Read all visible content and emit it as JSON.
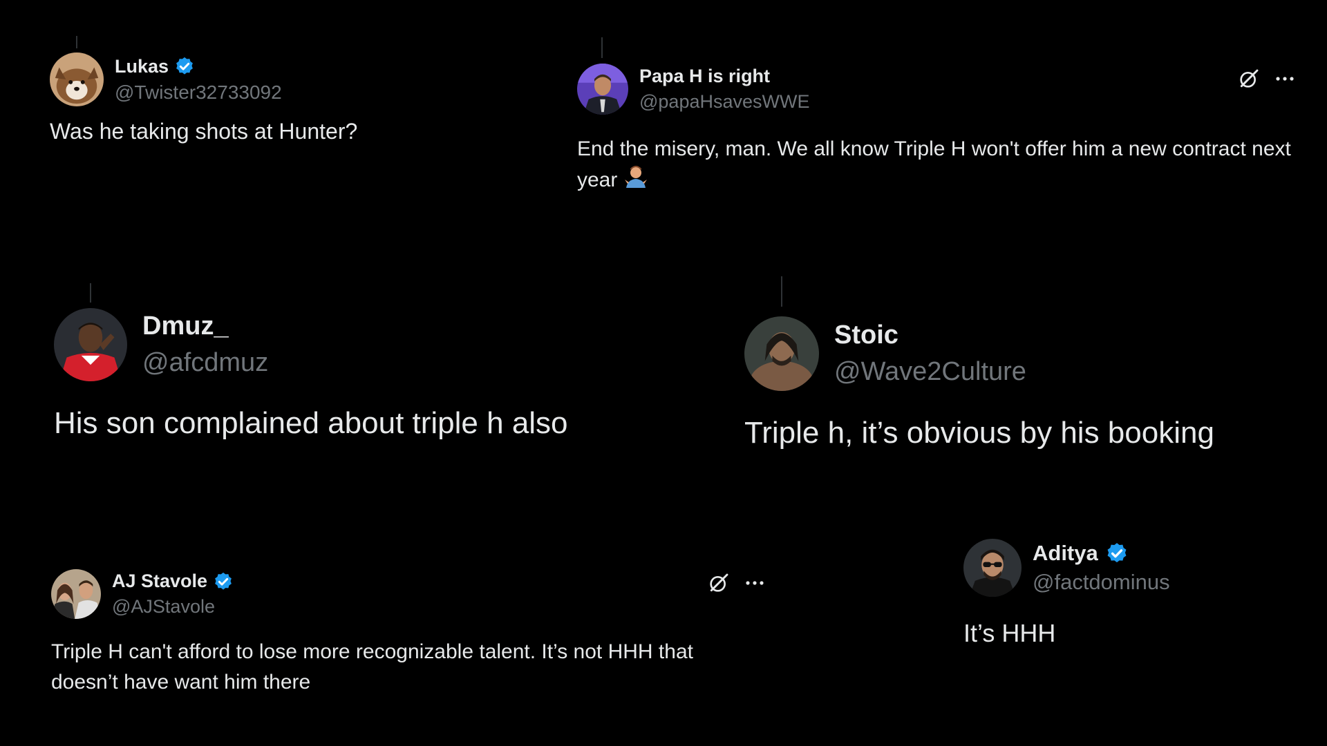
{
  "colors": {
    "background": "#000000",
    "text": "#e7e9ea",
    "handle": "#71767b",
    "verified": "#1d9bf0"
  },
  "tweets": [
    {
      "name": "Lukas",
      "handle": "@Twister32733092",
      "verified": true,
      "avatar_icon": "dog-avatar",
      "text": "Was he taking shots at Hunter?"
    },
    {
      "name": "Papa H is right",
      "handle": "@papaHsavesWWE",
      "verified": false,
      "avatar_icon": "man-in-suit-avatar",
      "text": "End the misery, man. We all know Triple H won't offer him a new contract next year",
      "emoji_icon": "person-shrugging-emoji",
      "action_icons": [
        "grok-icon",
        "more-icon"
      ]
    },
    {
      "name": "Dmuz_",
      "handle": "@afcdmuz",
      "verified": false,
      "avatar_icon": "footballer-avatar",
      "text": "His son complained about triple h also"
    },
    {
      "name": "Stoic",
      "handle": "@Wave2Culture",
      "verified": false,
      "avatar_icon": "wrestler-avatar",
      "text": "Triple h, it’s obvious by his booking"
    },
    {
      "name": "AJ Stavole",
      "handle": "@AJStavole",
      "verified": true,
      "avatar_icon": "couple-avatar",
      "text": "Triple H can't afford to lose more recognizable talent. It’s not HHH that doesn’t have want him there",
      "action_icons": [
        "grok-icon",
        "more-icon"
      ]
    },
    {
      "name": "Aditya",
      "handle": "@factdominus",
      "verified": true,
      "avatar_icon": "man-sunglasses-avatar",
      "text": "It’s HHH"
    }
  ]
}
